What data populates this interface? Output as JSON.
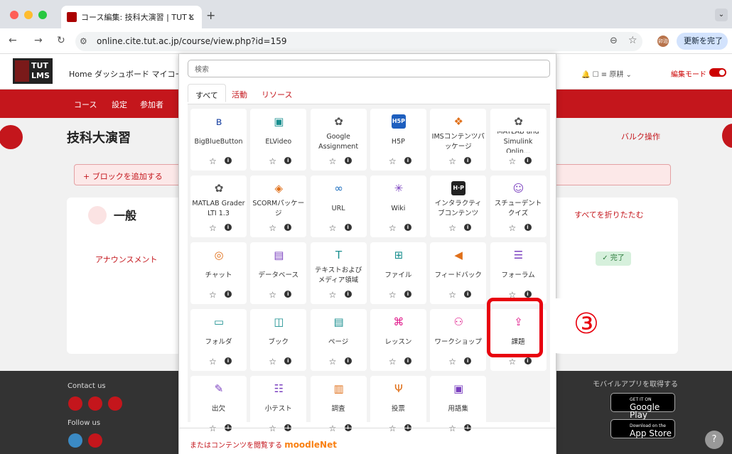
{
  "browser": {
    "tab_title": "コース編集: 技科大演習 | TUT L",
    "url": "online.cite.tut.ac.jp/course/view.php?id=159",
    "update_label": "更新を完了",
    "avatar_text": "卯治"
  },
  "header": {
    "logo_text": "TUT LMS",
    "nav": "Home  ダッシュボード  マイコー",
    "user": "原耕",
    "edit_mode": "編集モード"
  },
  "secondary_nav": [
    "コース",
    "設定",
    "参加者"
  ],
  "course": {
    "title": "技科大演習",
    "bulk": "バルク操作",
    "add_block": "+ ブロックを追加する",
    "section": "一般",
    "collapse_all": "すべてを折りたたむ",
    "announcement": "アナウンスメント",
    "done": "✓ 完了"
  },
  "footer": {
    "contact": "Contact us",
    "follow": "Follow us",
    "app": "モバイルアプリを取得する",
    "google_play": "Google Play",
    "app_store": "App Store",
    "google_play_small": "GET IT ON",
    "app_store_small": "Download on the"
  },
  "modal": {
    "search_placeholder": "検索",
    "tabs": [
      "すべて",
      "活動",
      "リソース"
    ],
    "moodlenet_text": "またはコンテンツを閲覧する",
    "moodlenet_brand": "moodleNet",
    "modules": [
      {
        "name": "BigBlueButton",
        "icon": "bigbluebutton-icon",
        "glyph": "ʙ",
        "color": "#2a4fa8"
      },
      {
        "name": "ELVideo",
        "icon": "video-icon",
        "glyph": "▣",
        "color": "#1a8f8f"
      },
      {
        "name": "Google Assignment",
        "icon": "puzzle-icon",
        "glyph": "✿",
        "color": "#555"
      },
      {
        "name": "H5P",
        "icon": "h5p-icon",
        "glyph": "H5P",
        "color": "#1e5fbf"
      },
      {
        "name": "IMSコンテンツパッケージ",
        "icon": "package-icon",
        "glyph": "❖",
        "color": "#e0701a"
      },
      {
        "name": "MATLAB and Simulink Onlin...",
        "icon": "puzzle-icon",
        "glyph": "✿",
        "color": "#555"
      },
      {
        "name": "MATLAB Grader LTI 1.3",
        "icon": "puzzle-icon",
        "glyph": "✿",
        "color": "#555"
      },
      {
        "name": "SCORMパッケージ",
        "icon": "scorm-icon",
        "glyph": "◈",
        "color": "#e0701a"
      },
      {
        "name": "URL",
        "icon": "link-icon",
        "glyph": "∞",
        "color": "#1e6fbf"
      },
      {
        "name": "Wiki",
        "icon": "wiki-icon",
        "glyph": "✳",
        "color": "#7a3fbf"
      },
      {
        "name": "インタラクティブコンテンツ",
        "icon": "h5p-icon",
        "glyph": "H·P",
        "color": "#222"
      },
      {
        "name": "スチューデントクイズ",
        "icon": "student-quiz-icon",
        "glyph": "☺",
        "color": "#7a3fbf"
      },
      {
        "name": "チャット",
        "icon": "chat-icon",
        "glyph": "◎",
        "color": "#e0701a"
      },
      {
        "name": "データベース",
        "icon": "database-icon",
        "glyph": "▤",
        "color": "#7a3fbf"
      },
      {
        "name": "テキストおよびメディア領域",
        "icon": "text-media-icon",
        "glyph": "T",
        "color": "#1a8f8f"
      },
      {
        "name": "ファイル",
        "icon": "file-icon",
        "glyph": "⊞",
        "color": "#1a8f8f"
      },
      {
        "name": "フィードバック",
        "icon": "feedback-icon",
        "glyph": "◀",
        "color": "#e0701a"
      },
      {
        "name": "フォーラム",
        "icon": "forum-icon",
        "glyph": "☰",
        "color": "#7a3fbf"
      },
      {
        "name": "フォルダ",
        "icon": "folder-icon",
        "glyph": "▭",
        "color": "#1a8f8f"
      },
      {
        "name": "ブック",
        "icon": "book-icon",
        "glyph": "◫",
        "color": "#1a8f8f"
      },
      {
        "name": "ページ",
        "icon": "page-icon",
        "glyph": "▤",
        "color": "#1a8f8f"
      },
      {
        "name": "レッスン",
        "icon": "lesson-icon",
        "glyph": "⌘",
        "color": "#e0188a"
      },
      {
        "name": "ワークショップ",
        "icon": "workshop-icon",
        "glyph": "⚇",
        "color": "#e0188a"
      },
      {
        "name": "課題",
        "icon": "assignment-icon",
        "glyph": "⇪",
        "color": "#e0188a"
      },
      {
        "name": "出欠",
        "icon": "attendance-icon",
        "glyph": "✎",
        "color": "#7a3fbf"
      },
      {
        "name": "小テスト",
        "icon": "quiz-icon",
        "glyph": "☷",
        "color": "#7a3fbf"
      },
      {
        "name": "調査",
        "icon": "survey-icon",
        "glyph": "▥",
        "color": "#e0701a"
      },
      {
        "name": "投票",
        "icon": "choice-icon",
        "glyph": "Ψ",
        "color": "#e0701a"
      },
      {
        "name": "用語集",
        "icon": "glossary-icon",
        "glyph": "▣",
        "color": "#7a3fbf"
      }
    ]
  },
  "annotation": {
    "label": "③",
    "color": "#e8000e"
  }
}
